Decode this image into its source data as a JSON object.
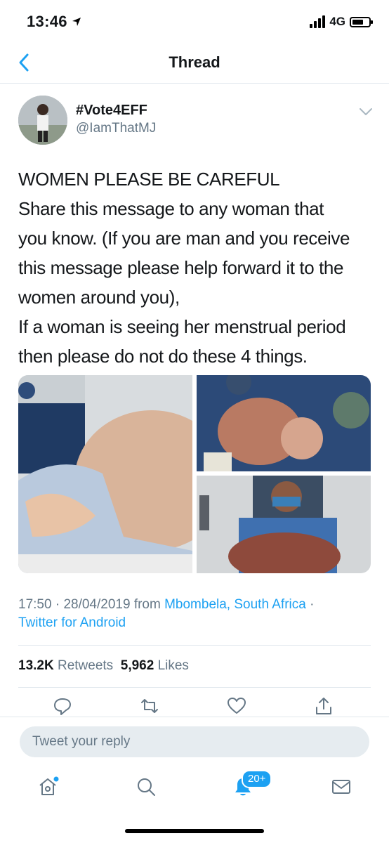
{
  "status_bar": {
    "time": "13:46",
    "network": "4G"
  },
  "nav": {
    "title": "Thread"
  },
  "tweet": {
    "display_name": "#Vote4EFF",
    "handle": "@IamThatMJ",
    "text_lines": [
      "WOMEN PLEASE BE CAREFUL",
      "Share this message to any woman that",
      "you know. (If you are man and you receive",
      "this message please help forward it to the",
      "women around you),",
      "If a woman is seeing her menstrual period",
      "then please do not do these 4 things."
    ],
    "time": "17:50",
    "sep": "·",
    "date": "28/04/2019",
    "from_label": "from",
    "location": "Mbombela, South Africa",
    "client": "Twitter for Android",
    "retweets_count": "13.2K",
    "retweets_label": "Retweets",
    "likes_count": "5,962",
    "likes_label": "Likes"
  },
  "reply": {
    "placeholder": "Tweet your reply"
  },
  "tab_bar": {
    "notifications_badge": "20+"
  },
  "colors": {
    "accent": "#1da1f2",
    "secondary_text": "#657786",
    "divider": "#e1e8ed"
  },
  "icons": [
    "back-chevron-icon",
    "caret-down-icon",
    "reply-icon",
    "retweet-icon",
    "like-icon",
    "share-icon",
    "home-icon",
    "search-icon",
    "notifications-icon",
    "messages-icon"
  ]
}
